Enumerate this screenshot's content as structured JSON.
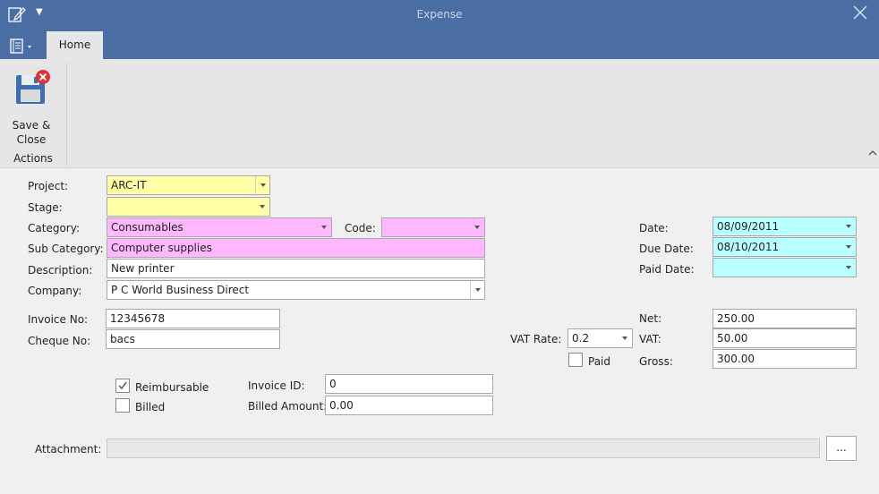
{
  "window": {
    "title": "Expense"
  },
  "ribbon": {
    "tab_home": "Home",
    "save_close_label": "Save &\nClose",
    "group_actions": "Actions"
  },
  "form": {
    "project": {
      "label": "Project:",
      "value": "ARC-IT"
    },
    "stage": {
      "label": "Stage:",
      "value": ""
    },
    "category": {
      "label": "Category:",
      "value": "Consumables"
    },
    "code": {
      "label": "Code:",
      "value": ""
    },
    "sub_category": {
      "label": "Sub Category:",
      "value": "Computer supplies"
    },
    "description": {
      "label": "Description:",
      "value": "New printer"
    },
    "company": {
      "label": "Company:",
      "value": "P C World Business Direct"
    },
    "date": {
      "label": "Date:",
      "value": "08/09/2011"
    },
    "due_date": {
      "label": "Due Date:",
      "value": "08/10/2011"
    },
    "paid_date": {
      "label": "Paid Date:",
      "value": ""
    },
    "invoice_no": {
      "label": "Invoice No:",
      "value": "12345678"
    },
    "cheque_no": {
      "label": "Cheque No:",
      "value": "bacs"
    },
    "vat_rate": {
      "label": "VAT Rate:",
      "value": "0.2"
    },
    "paid": {
      "label": "Paid",
      "checked": false
    },
    "net": {
      "label": "Net:",
      "value": "250.00"
    },
    "vat": {
      "label": "VAT:",
      "value": "50.00"
    },
    "gross": {
      "label": "Gross:",
      "value": "300.00"
    },
    "reimbursable": {
      "label": "Reimbursable",
      "checked": true
    },
    "billed": {
      "label": "Billed",
      "checked": false
    },
    "invoice_id": {
      "label": "Invoice ID:",
      "value": "0"
    },
    "billed_amount": {
      "label": "Billed Amount:",
      "value": "0.00"
    },
    "attachment": {
      "label": "Attachment:",
      "value": "",
      "browse_label": "..."
    }
  },
  "colors": {
    "titlebar": "#4a6ea3",
    "required_yellow": "#ffffa8",
    "required_pink": "#ffb8ff",
    "date_cyan": "#b8ffff"
  }
}
